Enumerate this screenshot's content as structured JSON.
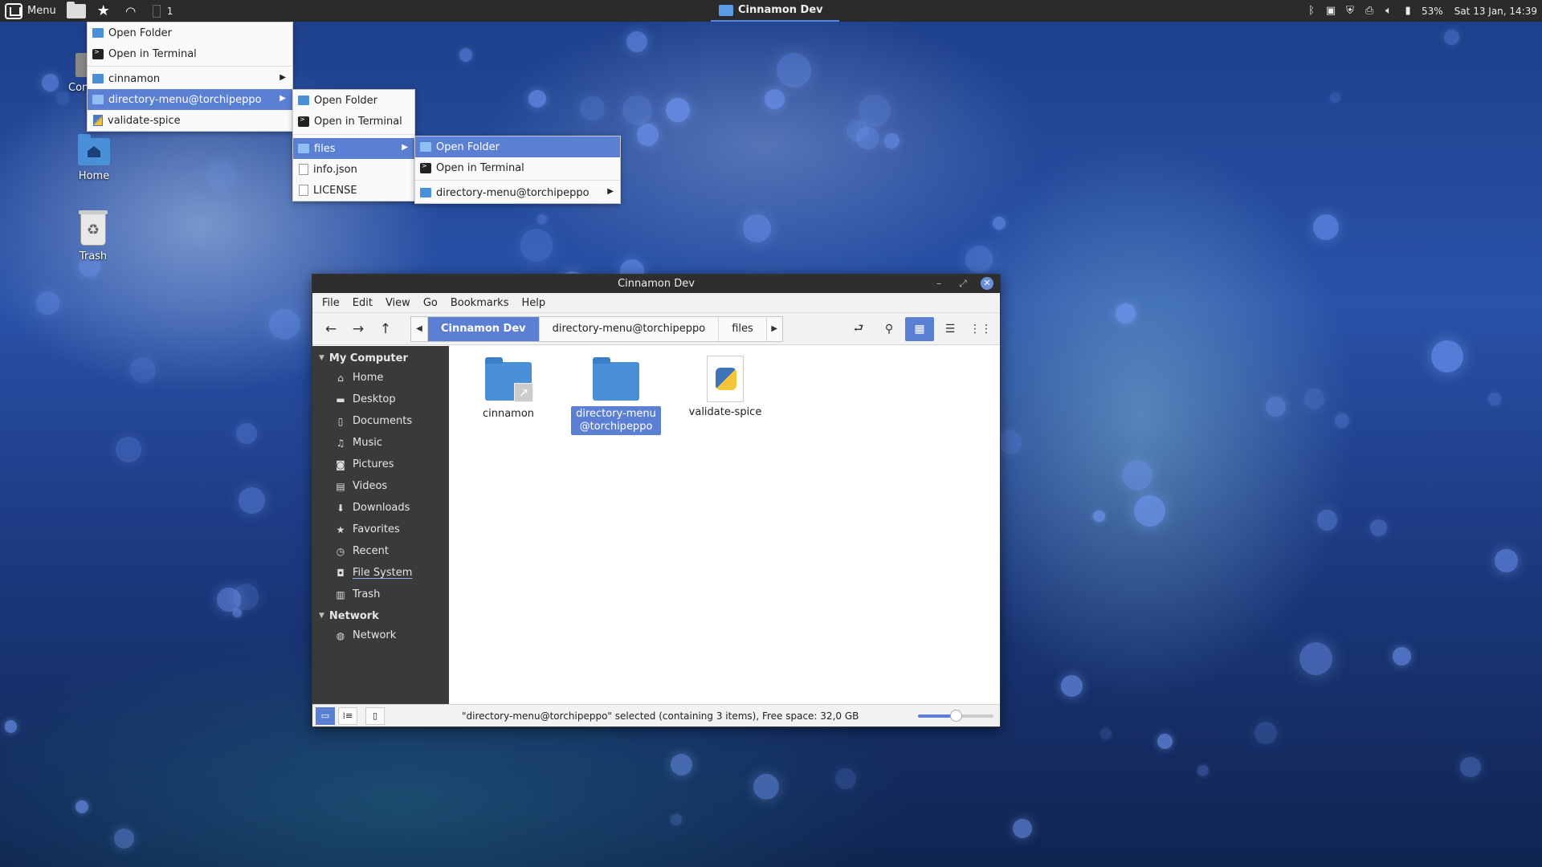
{
  "panel": {
    "menu_label": "Menu",
    "workspace": "1",
    "task_title": "Cinnamon Dev",
    "battery": "53%",
    "clock": "Sat 13 Jan, 14:39"
  },
  "desktop": {
    "partial_label": "Con",
    "home_label": "Home",
    "trash_label": "Trash"
  },
  "menus": {
    "level1": {
      "items": [
        "Open Folder",
        "Open in Terminal",
        "cinnamon",
        "directory-menu@torchipeppo",
        "validate-spice"
      ]
    },
    "level2": {
      "items": [
        "Open Folder",
        "Open in Terminal",
        "files",
        "info.json",
        "LICENSE"
      ]
    },
    "level3": {
      "items": [
        "Open Folder",
        "Open in Terminal",
        "directory-menu@torchipeppo"
      ]
    }
  },
  "window": {
    "title": "Cinnamon Dev",
    "menubar": [
      "File",
      "Edit",
      "View",
      "Go",
      "Bookmarks",
      "Help"
    ],
    "breadcrumbs": [
      "Cinnamon Dev",
      "directory-menu@torchipeppo",
      "files"
    ],
    "sidebar": {
      "my_computer": "My Computer",
      "places": [
        "Home",
        "Desktop",
        "Documents",
        "Music",
        "Pictures",
        "Videos",
        "Downloads",
        "Favorites",
        "Recent",
        "File System",
        "Trash"
      ],
      "network_header": "Network",
      "network_items": [
        "Network"
      ]
    },
    "files": [
      "cinnamon",
      "directory-menu@torchipeppo",
      "validate-spice"
    ],
    "status_text": "\"directory-menu@torchipeppo\" selected (containing 3 items), Free space: 32,0 GB",
    "zoom_level": 0.5
  },
  "colors": {
    "accent": "#5b7fd3",
    "folder": "#4a90d9",
    "sidebar_bg": "#3a3a3a",
    "panel_bg": "#2b2b2b"
  }
}
